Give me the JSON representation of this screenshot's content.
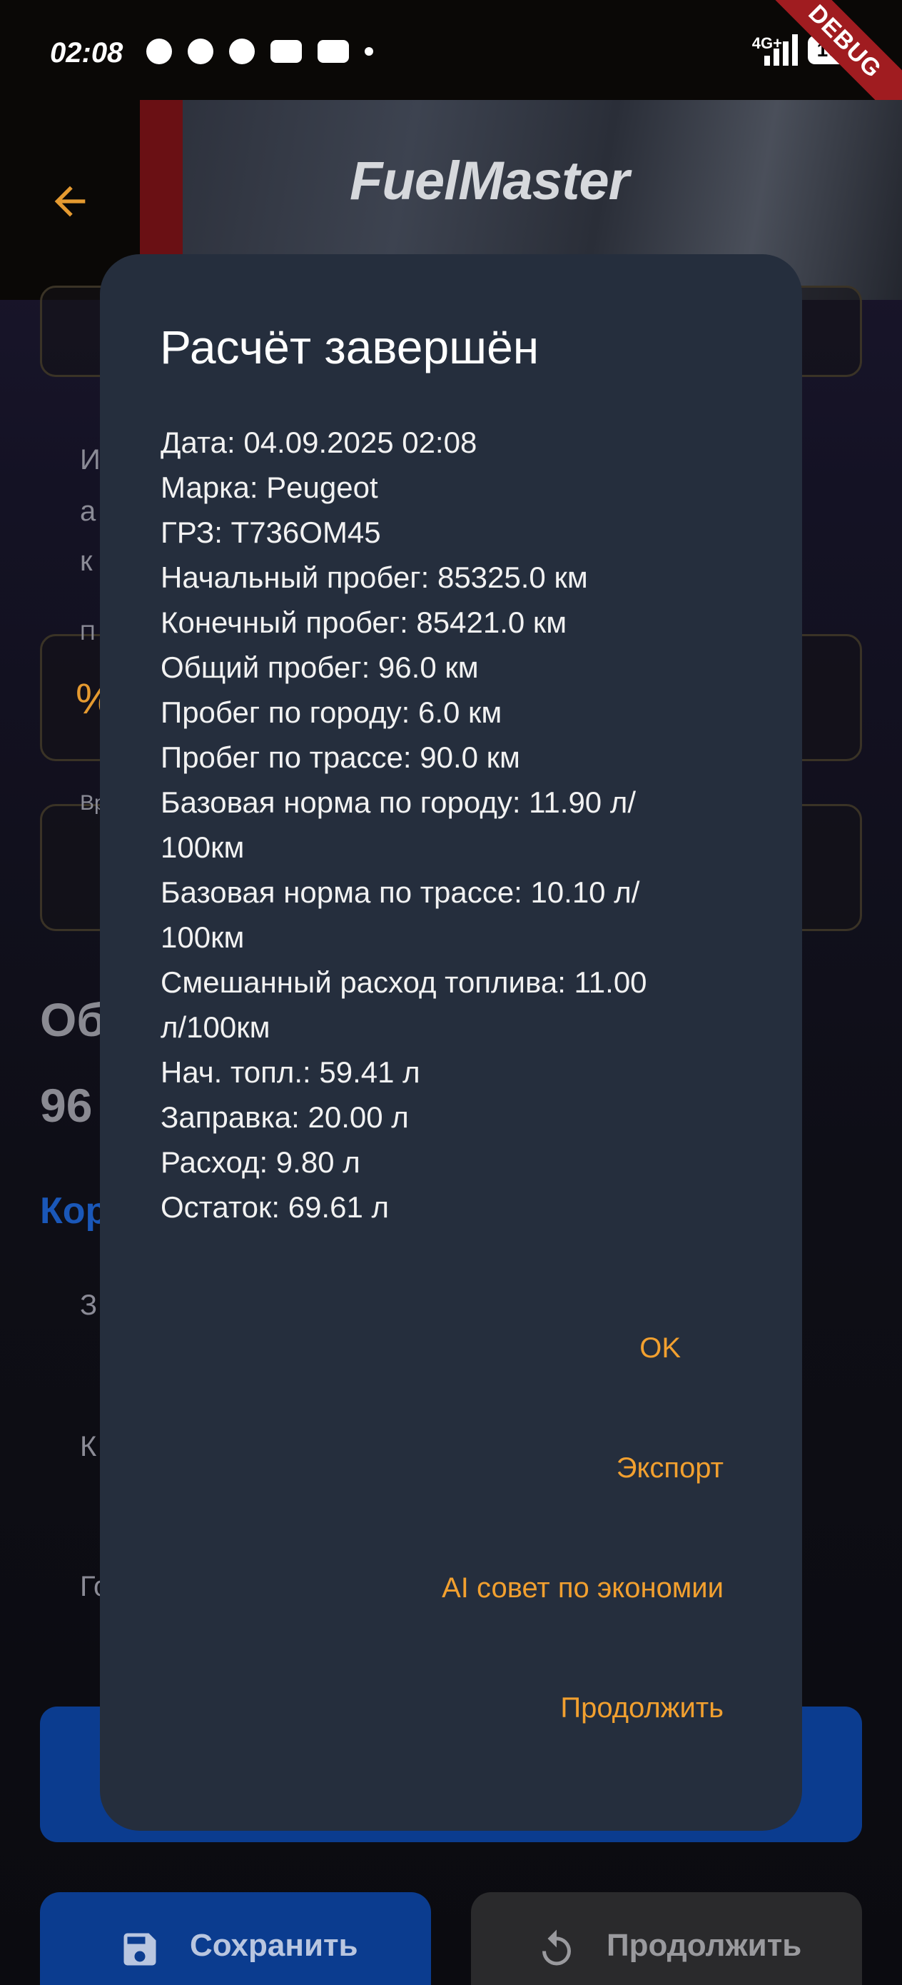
{
  "status_bar": {
    "time": "02:08",
    "network": "4G+",
    "battery": "100",
    "debug_label": "DEBUG"
  },
  "header": {
    "brand": "FuelMaster"
  },
  "background": {
    "fragments": [
      "И",
      "а",
      "к",
      "П",
      "Вр",
      "Об",
      "96",
      "Кор",
      "З",
      "К",
      "Го"
    ]
  },
  "bottom_buttons": {
    "save_label": "Сохранить",
    "continue_label": "Продолжить"
  },
  "dialog": {
    "title": "Расчёт завершён",
    "lines": [
      "Дата: 04.09.2025 02:08",
      "Марка: Peugeot",
      "ГРЗ: Т736ОМ45",
      "Начальный пробег: 85325.0 км",
      "Конечный пробег: 85421.0 км",
      "Общий пробег: 96.0 км",
      "Пробег по городу: 6.0 км",
      "Пробег по трассе: 90.0 км",
      "Базовая норма по городу: 11.90 л/",
      "100км",
      "Базовая норма по трассе: 10.10 л/",
      "100км",
      "Смешанный расход топлива: 11.00",
      "л/100км",
      "Нач. топл.: 59.41 л",
      "Заправка: 20.00 л",
      "Расход: 9.80 л",
      "Остаток: 69.61 л"
    ],
    "actions": {
      "ok": "OK",
      "export": "Экспорт",
      "ai_advice": "AI совет по экономии",
      "continue": "Продолжить"
    }
  },
  "colors": {
    "accent": "#f2a02f",
    "dialog_bg": "#252e3d",
    "primary_blue": "#0b3c8f"
  }
}
